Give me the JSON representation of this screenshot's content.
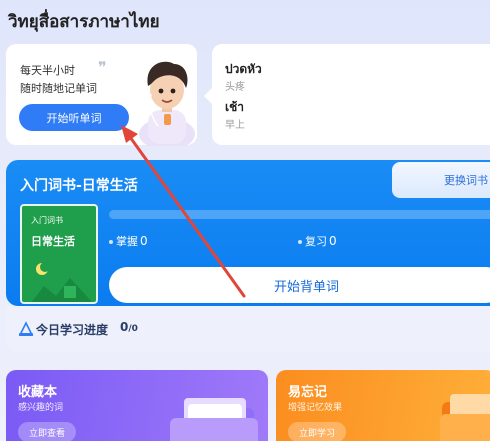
{
  "app": {
    "title": "วิทยุสื่อสารภาษาไทย"
  },
  "promo": {
    "line1": "每天半小时",
    "line2": "随时随地记单词",
    "button_label": "开始听单词"
  },
  "words": [
    {
      "thai": "ปวดหัว",
      "chinese": "头疼"
    },
    {
      "thai": "เช้า",
      "chinese": "早上"
    }
  ],
  "book": {
    "title": "入门词书-日常生活",
    "change_label": "更换词书",
    "cover_small": "入门词书",
    "cover_big": "日常生活",
    "progress_fraction": 0,
    "stats": [
      {
        "label": "掌握",
        "value": "0"
      },
      {
        "label": "复习",
        "value": "0"
      }
    ],
    "start_label": "开始背单词"
  },
  "today": {
    "label": "今日学习进度",
    "done": "0",
    "total": "/0"
  },
  "cards": {
    "collect": {
      "title": "收藏本",
      "subtitle": "感兴趣的词",
      "button": "立即查看"
    },
    "memo": {
      "title": "易忘记",
      "subtitle": "增强记忆效果",
      "button": "立即学习"
    }
  },
  "colors": {
    "accent": "#2f7cf6",
    "book_blue": "#0b7cf0",
    "cover_green": "#1f9e4c",
    "purple": "#7a5af5",
    "orange": "#fb8d1f",
    "annotation_arrow": "#e0463a"
  }
}
